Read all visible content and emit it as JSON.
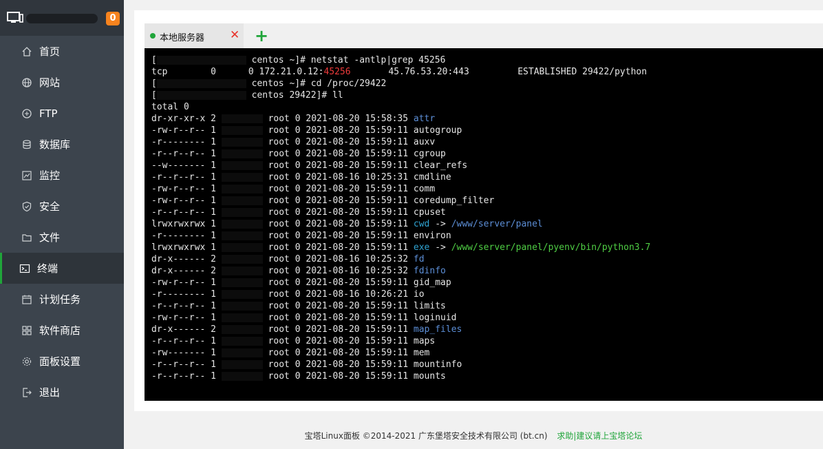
{
  "sidebar": {
    "server_badge": "0",
    "items": [
      {
        "label": "首页",
        "icon": "home-icon"
      },
      {
        "label": "网站",
        "icon": "globe-icon"
      },
      {
        "label": "FTP",
        "icon": "ftp-icon"
      },
      {
        "label": "数据库",
        "icon": "database-icon"
      },
      {
        "label": "监控",
        "icon": "monitor-chart-icon"
      },
      {
        "label": "安全",
        "icon": "shield-icon"
      },
      {
        "label": "文件",
        "icon": "folder-icon"
      },
      {
        "label": "终端",
        "icon": "terminal-icon",
        "active": true
      },
      {
        "label": "计划任务",
        "icon": "calendar-icon"
      },
      {
        "label": "软件商店",
        "icon": "apps-grid-icon"
      },
      {
        "label": "面板设置",
        "icon": "gear-icon"
      },
      {
        "label": "退出",
        "icon": "logout-icon"
      }
    ]
  },
  "tabs": {
    "active_label": "本地服务器",
    "close_symbol": "✕",
    "add_symbol": "+"
  },
  "terminal": {
    "lines": [
      {
        "segments": [
          {
            "t": "["
          },
          {
            "mask": 130
          },
          {
            "t": " centos ~]# netstat -antlp|grep 45256"
          }
        ]
      },
      {
        "segments": [
          {
            "t": "tcp        0      0 172.21.0.12:"
          },
          {
            "t": "45256",
            "c": "red"
          },
          {
            "t": "       45.76.53.20:443         ESTABLISHED 29422/python"
          }
        ]
      },
      {
        "segments": [
          {
            "t": "["
          },
          {
            "mask": 130
          },
          {
            "t": " centos ~]# cd /proc/29422"
          }
        ]
      },
      {
        "segments": [
          {
            "t": "["
          },
          {
            "mask": 130
          },
          {
            "t": " centos 29422]# ll"
          }
        ]
      },
      {
        "segments": [
          {
            "t": "total 0"
          }
        ]
      },
      {
        "segments": [
          {
            "t": "dr-xr-xr-x 2 "
          },
          {
            "mask": 60
          },
          {
            "t": " root 0 2021-08-20 15:58:35 "
          },
          {
            "t": "attr",
            "c": "blue"
          }
        ]
      },
      {
        "segments": [
          {
            "t": "-rw-r--r-- 1 "
          },
          {
            "mask": 60
          },
          {
            "t": " root 0 2021-08-20 15:59:11 autogroup"
          }
        ]
      },
      {
        "segments": [
          {
            "t": "-r-------- 1 "
          },
          {
            "mask": 60
          },
          {
            "t": " root 0 2021-08-20 15:59:11 auxv"
          }
        ]
      },
      {
        "segments": [
          {
            "t": "-r--r--r-- 1 "
          },
          {
            "mask": 60
          },
          {
            "t": " root 0 2021-08-20 15:59:11 cgroup"
          }
        ]
      },
      {
        "segments": [
          {
            "t": "--w------- 1 "
          },
          {
            "mask": 60
          },
          {
            "t": " root 0 2021-08-20 15:59:11 clear_refs"
          }
        ]
      },
      {
        "segments": [
          {
            "t": "-r--r--r-- 1 "
          },
          {
            "mask": 60
          },
          {
            "t": " root 0 2021-08-16 10:25:31 cmdline"
          }
        ]
      },
      {
        "segments": [
          {
            "t": "-rw-r--r-- 1 "
          },
          {
            "mask": 60
          },
          {
            "t": " root 0 2021-08-20 15:59:11 comm"
          }
        ]
      },
      {
        "segments": [
          {
            "t": "-rw-r--r-- 1 "
          },
          {
            "mask": 60
          },
          {
            "t": " root 0 2021-08-20 15:59:11 coredump_filter"
          }
        ]
      },
      {
        "segments": [
          {
            "t": "-r--r--r-- 1 "
          },
          {
            "mask": 60
          },
          {
            "t": " root 0 2021-08-20 15:59:11 cpuset"
          }
        ]
      },
      {
        "segments": [
          {
            "t": "lrwxrwxrwx 1 "
          },
          {
            "mask": 60
          },
          {
            "t": " root 0 2021-08-20 15:59:11 "
          },
          {
            "t": "cwd",
            "c": "cyan"
          },
          {
            "t": " -> "
          },
          {
            "t": "/www/server/panel",
            "c": "blue"
          }
        ]
      },
      {
        "segments": [
          {
            "t": "-r-------- 1 "
          },
          {
            "mask": 60
          },
          {
            "t": " root 0 2021-08-20 15:59:11 environ"
          }
        ]
      },
      {
        "segments": [
          {
            "t": "lrwxrwxrwx 1 "
          },
          {
            "mask": 60
          },
          {
            "t": " root 0 2021-08-20 15:59:11 "
          },
          {
            "t": "exe",
            "c": "cyan"
          },
          {
            "t": " -> "
          },
          {
            "t": "/www/server/panel/pyenv/bin/python3.7",
            "c": "green"
          }
        ]
      },
      {
        "segments": [
          {
            "t": "dr-x------ 2 "
          },
          {
            "mask": 60
          },
          {
            "t": " root 0 2021-08-16 10:25:32 "
          },
          {
            "t": "fd",
            "c": "blue"
          }
        ]
      },
      {
        "segments": [
          {
            "t": "dr-x------ 2 "
          },
          {
            "mask": 60
          },
          {
            "t": " root 0 2021-08-16 10:25:32 "
          },
          {
            "t": "fdinfo",
            "c": "blue"
          }
        ]
      },
      {
        "segments": [
          {
            "t": "-rw-r--r-- 1 "
          },
          {
            "mask": 60
          },
          {
            "t": " root 0 2021-08-20 15:59:11 gid_map"
          }
        ]
      },
      {
        "segments": [
          {
            "t": "-r-------- 1 "
          },
          {
            "mask": 60
          },
          {
            "t": " root 0 2021-08-16 10:26:21 io"
          }
        ]
      },
      {
        "segments": [
          {
            "t": "-r--r--r-- 1 "
          },
          {
            "mask": 60
          },
          {
            "t": " root 0 2021-08-20 15:59:11 limits"
          }
        ]
      },
      {
        "segments": [
          {
            "t": "-rw-r--r-- 1 "
          },
          {
            "mask": 60
          },
          {
            "t": " root 0 2021-08-20 15:59:11 loginuid"
          }
        ]
      },
      {
        "segments": [
          {
            "t": "dr-x------ 2 "
          },
          {
            "mask": 60
          },
          {
            "t": " root 0 2021-08-20 15:59:11 "
          },
          {
            "t": "map_files",
            "c": "blue"
          }
        ]
      },
      {
        "segments": [
          {
            "t": "-r--r--r-- 1 "
          },
          {
            "mask": 60
          },
          {
            "t": " root 0 2021-08-20 15:59:11 maps"
          }
        ]
      },
      {
        "segments": [
          {
            "t": "-rw------- 1 "
          },
          {
            "mask": 60
          },
          {
            "t": " root 0 2021-08-20 15:59:11 mem"
          }
        ]
      },
      {
        "segments": [
          {
            "t": "-r--r--r-- 1 "
          },
          {
            "mask": 60
          },
          {
            "t": " root 0 2021-08-20 15:59:11 mountinfo"
          }
        ]
      },
      {
        "segments": [
          {
            "t": "-r--r--r-- 1 "
          },
          {
            "mask": 60
          },
          {
            "t": " root 0 2021-08-20 15:59:11 mounts"
          }
        ]
      }
    ]
  },
  "footer": {
    "copyright": "宝塔Linux面板 ©2014-2021 广东堡塔安全技术有限公司 (bt.cn)",
    "link": "求助|建议请上宝塔论坛"
  },
  "colors": {
    "accent": "#20a53a",
    "sidebar_bg": "#3c444d",
    "badge": "#f7831e",
    "terminal_bg": "#000000"
  }
}
